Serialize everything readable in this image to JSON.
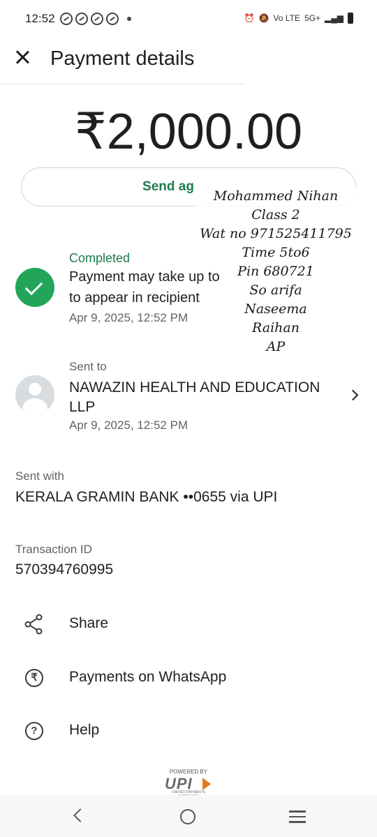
{
  "status_bar": {
    "time": "12:52",
    "network": "5G+",
    "volte": "Vo LTE"
  },
  "header": {
    "title": "Payment details",
    "close_icon": "close-icon"
  },
  "payment": {
    "amount": "₹2,000.00",
    "send_again_label": "Send ag"
  },
  "handwritten_note": {
    "lines": [
      "Mohammed Nihan",
      "Class 2",
      "Wat no 971525411795",
      "Time 5to6",
      "Pin 680721",
      "So arifa",
      "Naseema",
      "Raihan",
      "AP"
    ]
  },
  "status": {
    "label": "Completed",
    "message_line1": "Payment may take up to",
    "message_line2": "to appear in recipient",
    "date": "Apr 9, 2025, 12:52 PM",
    "color": "#22a559"
  },
  "recipient": {
    "label": "Sent to",
    "name": "NAWAZIN HEALTH AND EDUCATION LLP",
    "date": "Apr 9, 2025, 12:52 PM"
  },
  "sent_with": {
    "label": "Sent with",
    "value": "KERALA GRAMIN BANK ••0655 via UPI"
  },
  "transaction": {
    "label": "Transaction ID",
    "value": "570394760995"
  },
  "actions": [
    {
      "label": "Share",
      "icon": "share-icon"
    },
    {
      "label": "Payments on WhatsApp",
      "icon": "rupee-icon"
    },
    {
      "label": "Help",
      "icon": "help-icon"
    }
  ],
  "upi_badge": {
    "powered_by": "POWERED BY",
    "logo": "UPI",
    "tagline": "UNIFIED PAYMENTS INTERFACE"
  },
  "brand_colors": {
    "accent_green": "#1e7c4a",
    "check_green": "#22a559",
    "upi_orange": "#e27b1b"
  }
}
